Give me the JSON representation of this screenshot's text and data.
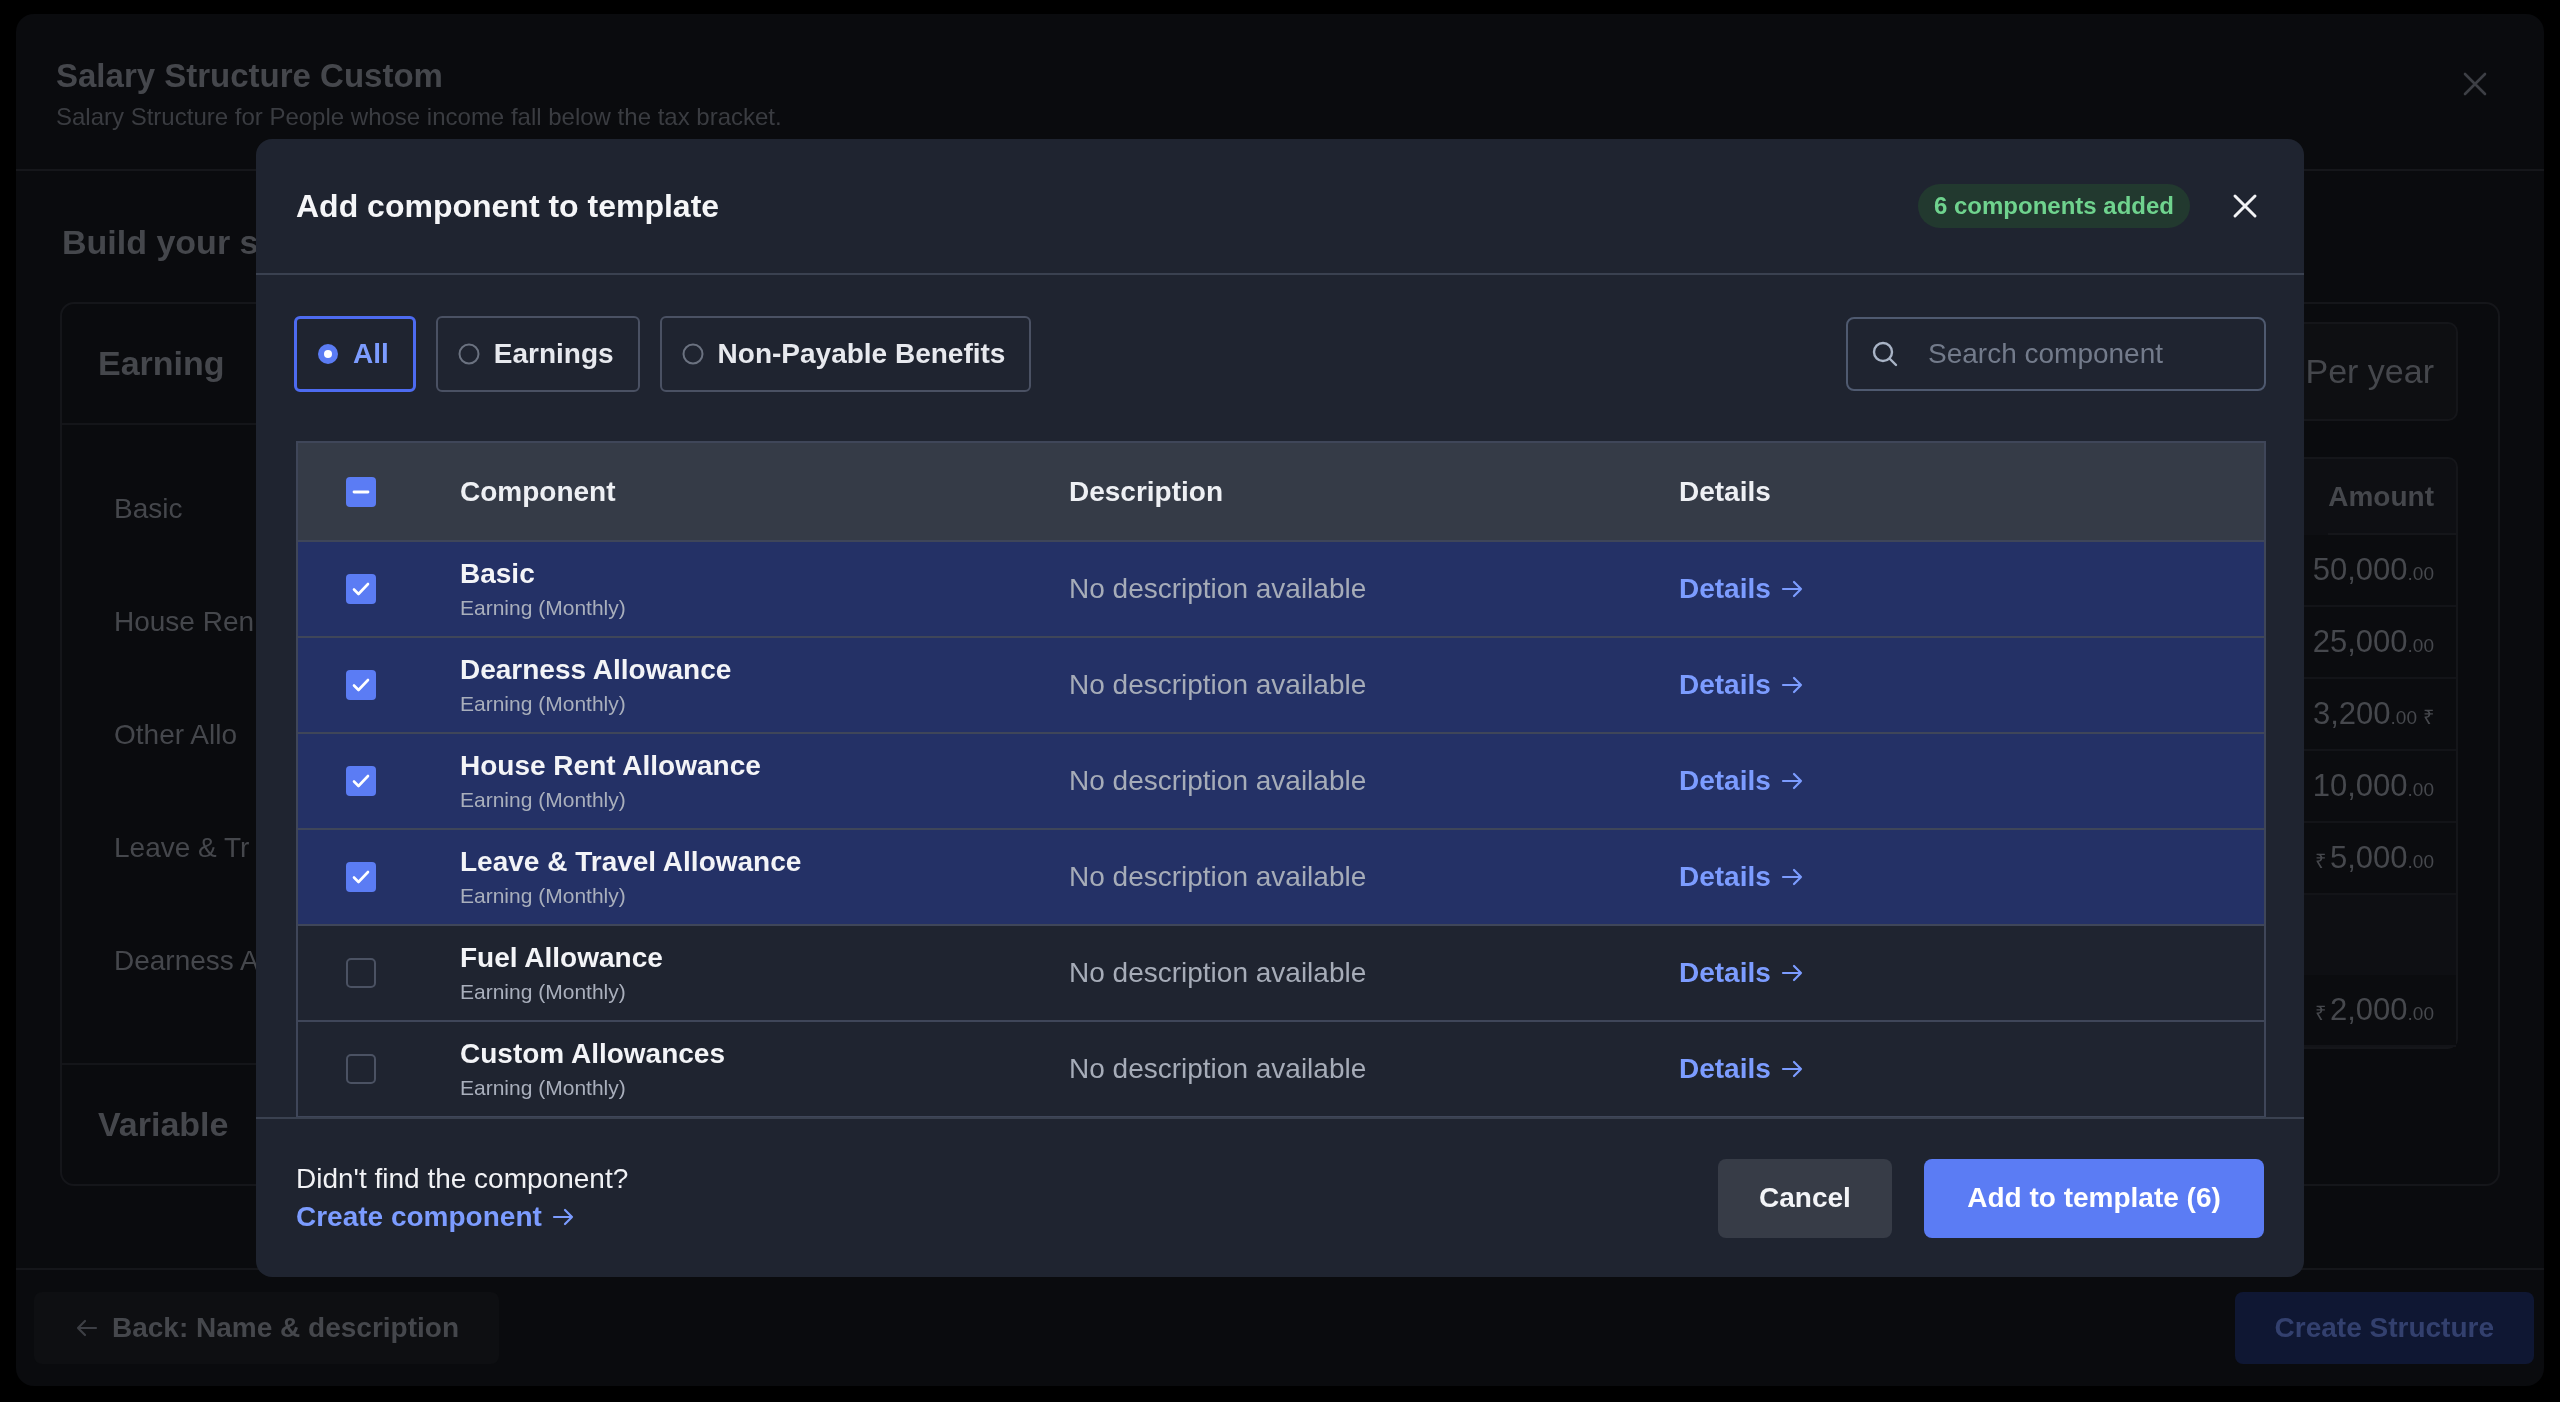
{
  "page": {
    "title": "Salary Structure Custom",
    "subtitle": "Salary Structure for People whose income fall below the tax bracket.",
    "section_title": "Build your s",
    "earning": {
      "title": "Earning",
      "items": [
        "Basic",
        "House Ren",
        "Other Allo",
        "Leave & Tr",
        "Dearness A"
      ]
    },
    "variable": {
      "title": "Variable"
    },
    "period": "Per year",
    "amount_header": "Amount",
    "amounts": [
      {
        "value": "50,000",
        "fraction": ".00"
      },
      {
        "value": "25,000",
        "fraction": ".00"
      },
      {
        "value": "3,200",
        "fraction": ".00",
        "suffix": "₹"
      },
      {
        "value": "10,000",
        "fraction": ".00"
      },
      {
        "prefix": "₹",
        "value": "5,000",
        "fraction": ".00"
      },
      {
        "prefix": "₹",
        "value": "2,000",
        "fraction": ".00"
      }
    ],
    "back_button": "Back: Name & description",
    "create_button": "Create Structure"
  },
  "dialog": {
    "title": "Add component to template",
    "badge": "6 components added",
    "filters": [
      {
        "label": "All",
        "selected": true
      },
      {
        "label": "Earnings",
        "selected": false
      },
      {
        "label": "Non-Payable Benefits",
        "selected": false
      }
    ],
    "search": {
      "placeholder": "Search component"
    },
    "table": {
      "select_all_indeterminate": true,
      "columns": [
        "Component",
        "Description",
        "Details"
      ],
      "rows": [
        {
          "name": "Basic",
          "type": "Earning (Monthly)",
          "description": "No description available",
          "link": "Details",
          "checked": true
        },
        {
          "name": "Dearness Allowance",
          "type": "Earning (Monthly)",
          "description": "No description available",
          "link": "Details",
          "checked": true
        },
        {
          "name": "House Rent Allowance",
          "type": "Earning (Monthly)",
          "description": "No description available",
          "link": "Details",
          "checked": true
        },
        {
          "name": "Leave & Travel Allowance",
          "type": "Earning (Monthly)",
          "description": "No description available",
          "link": "Details",
          "checked": true
        },
        {
          "name": "Fuel Allowance",
          "type": "Earning (Monthly)",
          "description": "No description available",
          "link": "Details",
          "checked": false
        },
        {
          "name": "Custom Allowances",
          "type": "Earning (Monthly)",
          "description": "No description available",
          "link": "Details",
          "checked": false
        }
      ]
    },
    "footer_prompt": "Didn't find the component?",
    "footer_link": "Create component",
    "cancel": "Cancel",
    "submit": "Add to template (6)"
  }
}
